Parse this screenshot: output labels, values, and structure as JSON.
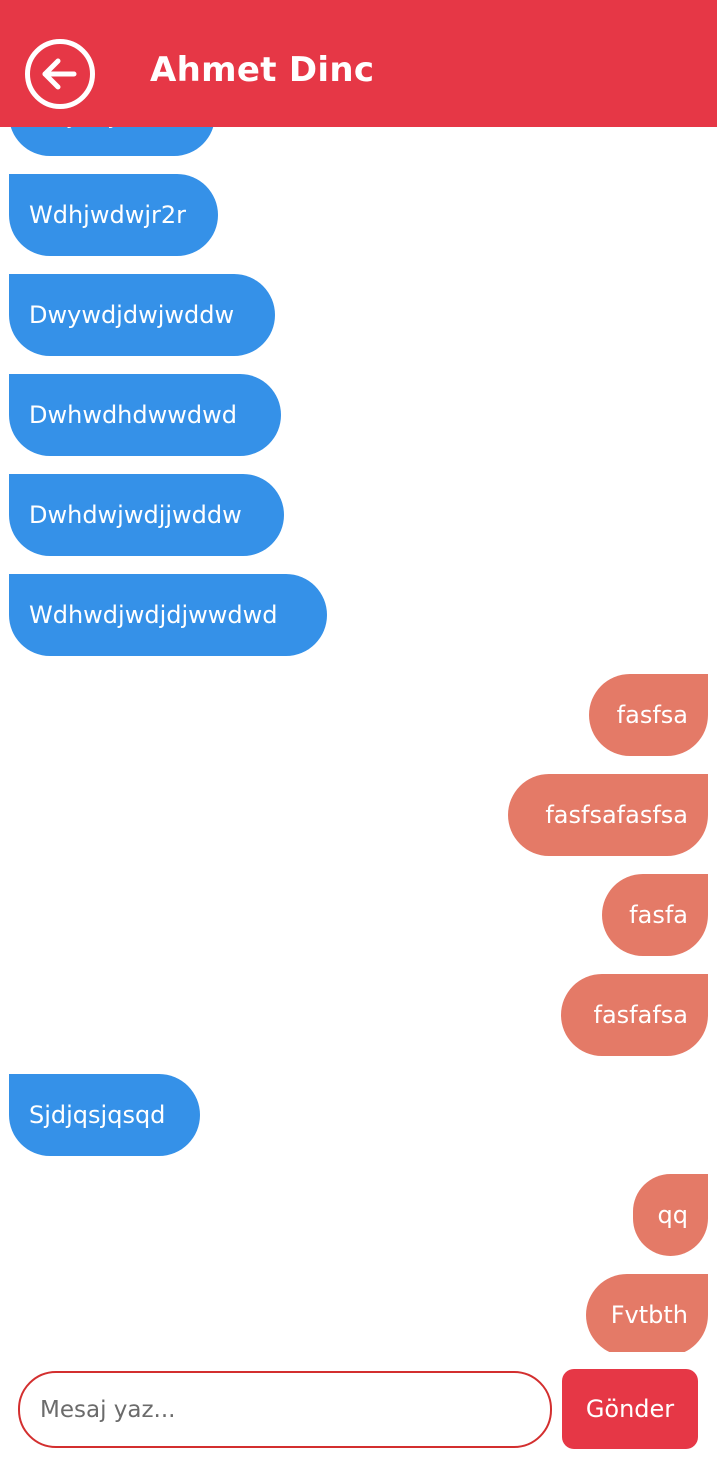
{
  "header": {
    "title": "Ahmet Dinc",
    "back_icon": "arrow-left-circle-icon",
    "color": "#E63746"
  },
  "colors": {
    "incoming": "#3591E8",
    "outgoing": "#E47A67",
    "accent": "#E63746"
  },
  "messages": [
    {
      "text": "Wdjwdjwdw",
      "sender": "incoming"
    },
    {
      "text": "Wdhjwdwjr2r",
      "sender": "incoming"
    },
    {
      "text": "Dwywdjdwjwddw",
      "sender": "incoming"
    },
    {
      "text": "Dwhwdhdwwdwd",
      "sender": "incoming"
    },
    {
      "text": "Dwhdwjwdjjwddw",
      "sender": "incoming"
    },
    {
      "text": "Wdhwdjwdjdjwwdwd",
      "sender": "incoming"
    },
    {
      "text": "fasfsa",
      "sender": "outgoing"
    },
    {
      "text": "fasfsafasfsa",
      "sender": "outgoing"
    },
    {
      "text": "fasfa",
      "sender": "outgoing"
    },
    {
      "text": "fasfafsa",
      "sender": "outgoing"
    },
    {
      "text": "Sjdjqsjqsqd",
      "sender": "incoming"
    },
    {
      "text": "qq",
      "sender": "outgoing"
    },
    {
      "text": "Fvtbth",
      "sender": "outgoing"
    }
  ],
  "composer": {
    "placeholder": "Mesaj yaz...",
    "value": "",
    "send_label": "Gönder"
  }
}
